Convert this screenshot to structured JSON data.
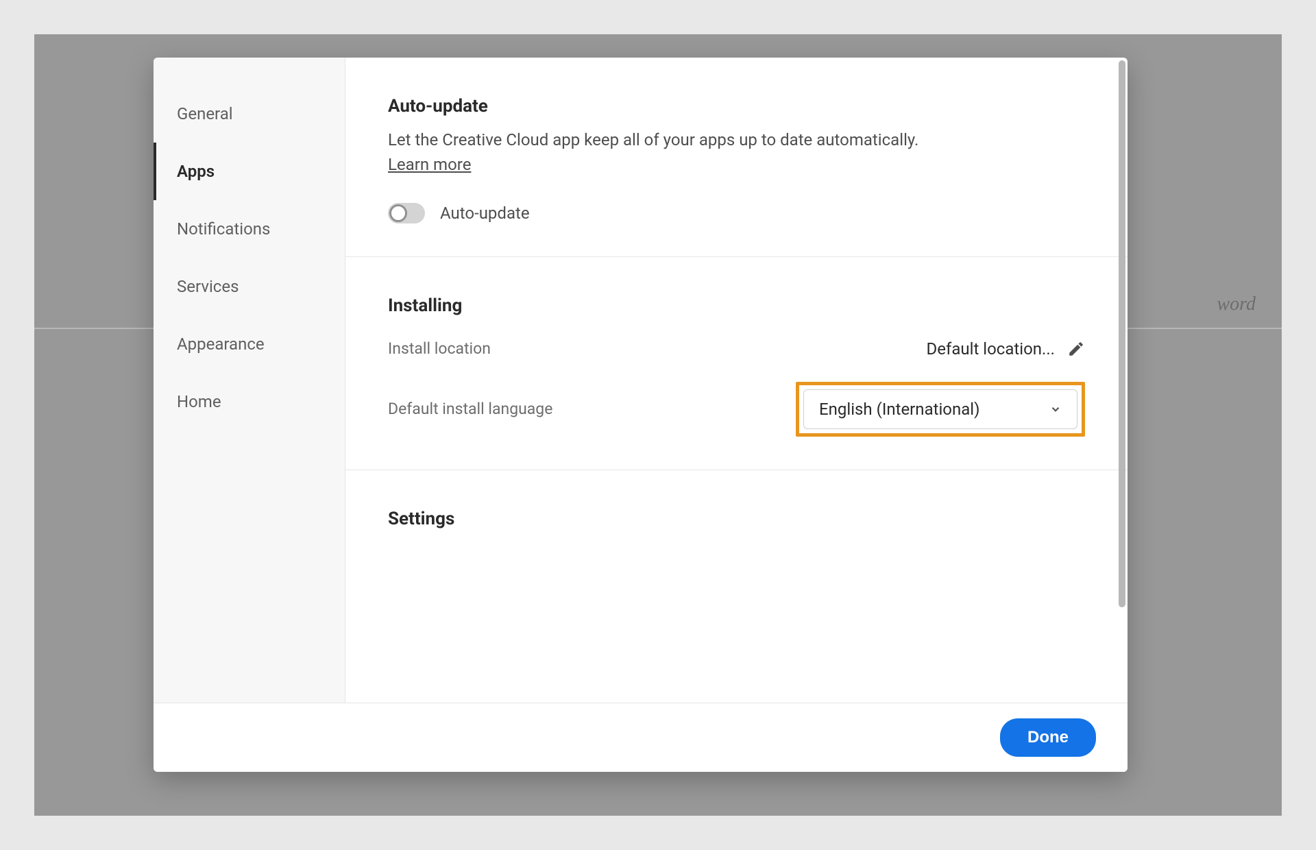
{
  "background": {
    "partial_text": "word"
  },
  "sidebar": {
    "items": [
      {
        "label": "General"
      },
      {
        "label": "Apps"
      },
      {
        "label": "Notifications"
      },
      {
        "label": "Services"
      },
      {
        "label": "Appearance"
      },
      {
        "label": "Home"
      }
    ]
  },
  "sections": {
    "auto_update": {
      "title": "Auto-update",
      "description": "Let the Creative Cloud app keep all of your apps up to date automatically.",
      "learn_more": "Learn more",
      "toggle_label": "Auto-update"
    },
    "installing": {
      "title": "Installing",
      "install_location_label": "Install location",
      "install_location_value": "Default location...",
      "default_language_label": "Default install language",
      "default_language_value": "English (International)"
    },
    "settings": {
      "title": "Settings"
    }
  },
  "footer": {
    "done": "Done"
  }
}
